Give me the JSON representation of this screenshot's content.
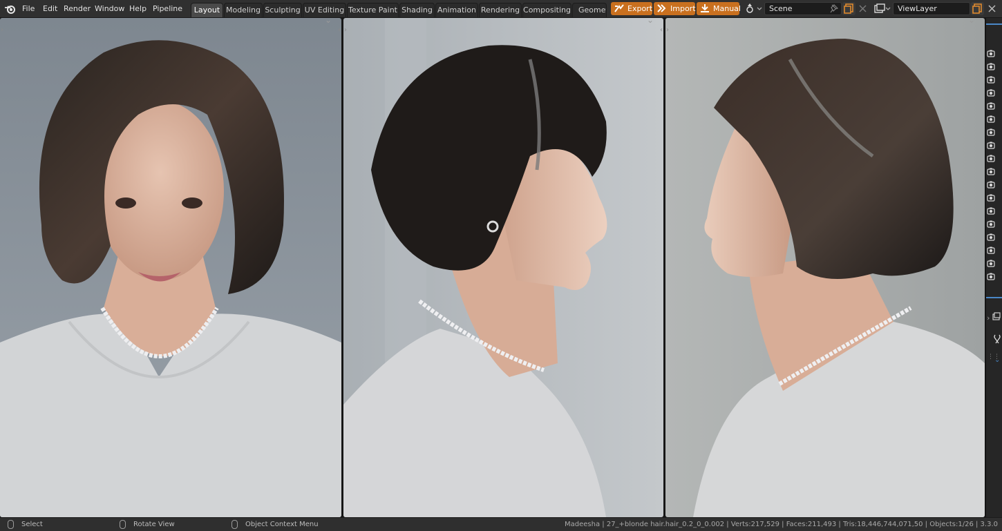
{
  "menus": [
    "File",
    "Edit",
    "Render",
    "Window",
    "Help",
    "Pipeline"
  ],
  "workspace_tabs": [
    {
      "label": "Layout",
      "active": true
    },
    {
      "label": "Modeling",
      "active": false
    },
    {
      "label": "Sculpting",
      "active": false
    },
    {
      "label": "UV Editing",
      "active": false
    },
    {
      "label": "Texture Paint",
      "active": false
    },
    {
      "label": "Shading",
      "active": false
    },
    {
      "label": "Animation",
      "active": false
    },
    {
      "label": "Rendering",
      "active": false
    },
    {
      "label": "Compositing",
      "active": false
    },
    {
      "label": "Geometr",
      "active": false
    }
  ],
  "addon_buttons": {
    "export": "Export",
    "import": "Import",
    "manual": "Manual",
    "color": "#c9701f"
  },
  "scene": {
    "name": "Scene"
  },
  "view_layer": {
    "name": "ViewLayer"
  },
  "statusbar": {
    "select": "Select",
    "rotate": "Rotate View",
    "context": "Object Context Menu",
    "stats": "Madeesha | 27_+blonde hair.hair_0.2_0_0.002 | Verts:217,529 | Faces:211,493 | Tris:18,446,744,071,50 | Objects:1/26 | 3.3.0"
  },
  "icons": {
    "logo": "blender-logo-icon",
    "camera": "camera-icon",
    "pin": "pin-icon"
  }
}
